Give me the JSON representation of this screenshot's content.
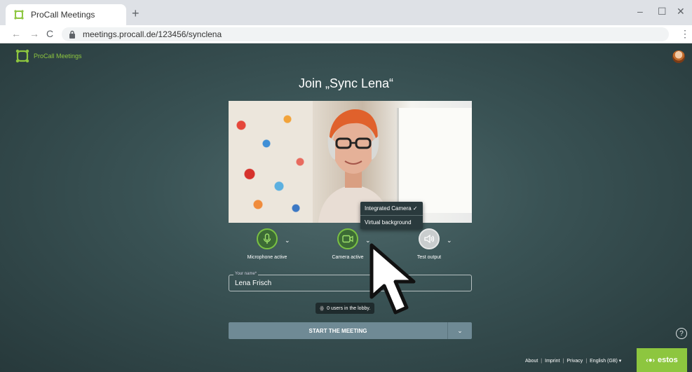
{
  "browser": {
    "tab_title": "ProCall Meetings",
    "new_tab": "+",
    "url": "meetings.procall.de/123456/synclena",
    "minimize": "–",
    "maximize": "☐",
    "close": "✕",
    "back": "←",
    "forward": "→",
    "reload": "C",
    "menu": "⋮"
  },
  "app": {
    "brand": "ProCall Meetings",
    "title": "Join „Sync Lena“",
    "camera_menu": {
      "items": [
        "Integrated Camera ✓",
        "Virtual background"
      ]
    },
    "controls": {
      "mic_label": "Microphone active",
      "camera_label": "Camera active",
      "output_label": "Test output",
      "caret": "⌄"
    },
    "name_field": {
      "legend": "Your name*",
      "value": "Lena Frisch"
    },
    "lobby_text": "0 users in the lobby.",
    "start_label": "START THE MEETING",
    "start_caret": "⌄",
    "help": "?",
    "footer": {
      "about": "About",
      "imprint": "Imprint",
      "privacy": "Privacy",
      "language": "English (GB) ▾",
      "sep": "|"
    },
    "estos": "estos"
  },
  "colors": {
    "accent_green": "#8dc63f",
    "button": "#6f8a95"
  }
}
